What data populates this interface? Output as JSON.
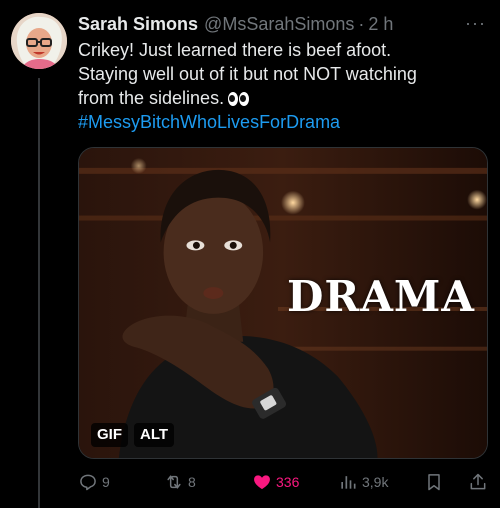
{
  "author": {
    "name": "Sarah Simons",
    "handle": "@MsSarahSimons",
    "separator": "·",
    "time": "2 h"
  },
  "more_label": "···",
  "tweet": {
    "line1": "Crikey! Just learned there is beef afoot.",
    "line2": "Staying well out of it but not NOT watching",
    "line3": "from the sidelines.",
    "hashtag": "#MessyBitchWhoLivesForDrama",
    "emoji": "eyes"
  },
  "media": {
    "overlay_text": "DRAMA",
    "gif_badge": "GIF",
    "alt_badge": "ALT"
  },
  "actions": {
    "replies": "9",
    "reposts": "8",
    "likes": "336",
    "views": "3,9k"
  },
  "colors": {
    "accent": "#1d9bf0",
    "like": "#f91880",
    "muted": "#71767b",
    "background": "#000000"
  }
}
